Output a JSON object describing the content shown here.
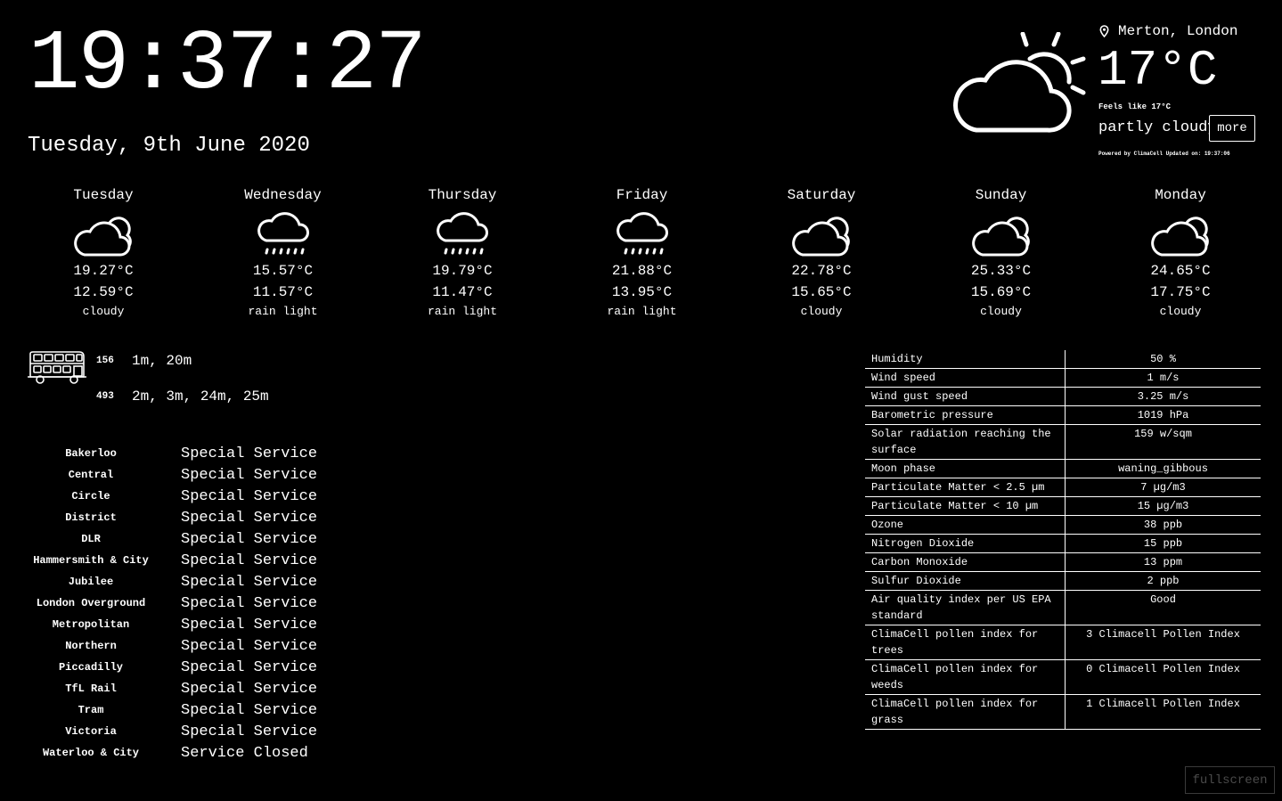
{
  "clock": {
    "time": "19:37:27",
    "date": "Tuesday, 9th June 2020"
  },
  "current": {
    "location": "Merton, London",
    "icon": "partly-cloudy-icon",
    "temperature": "17°C",
    "feels_like": "Feels like 17°C",
    "summary": "partly cloudy",
    "more_label": "more",
    "powered_by": "Powered by ClimaCell Updated on: 19:37:06"
  },
  "forecast": [
    {
      "day": "Tuesday",
      "icon": "cloudy-icon",
      "high": "19.27°C",
      "low": "12.59°C",
      "condition": "cloudy"
    },
    {
      "day": "Wednesday",
      "icon": "rain-light-icon",
      "high": "15.57°C",
      "low": "11.57°C",
      "condition": "rain light"
    },
    {
      "day": "Thursday",
      "icon": "rain-light-icon",
      "high": "19.79°C",
      "low": "11.47°C",
      "condition": "rain light"
    },
    {
      "day": "Friday",
      "icon": "rain-light-icon",
      "high": "21.88°C",
      "low": "13.95°C",
      "condition": "rain light"
    },
    {
      "day": "Saturday",
      "icon": "cloudy-icon",
      "high": "22.78°C",
      "low": "15.65°C",
      "condition": "cloudy"
    },
    {
      "day": "Sunday",
      "icon": "cloudy-icon",
      "high": "25.33°C",
      "low": "15.69°C",
      "condition": "cloudy"
    },
    {
      "day": "Monday",
      "icon": "cloudy-icon",
      "high": "24.65°C",
      "low": "17.75°C",
      "condition": "cloudy"
    }
  ],
  "buses": [
    {
      "route": "156",
      "times": "1m, 20m"
    },
    {
      "route": "493",
      "times": "2m, 3m, 24m, 25m"
    }
  ],
  "tube": [
    {
      "line": "Bakerloo",
      "status": "Special Service"
    },
    {
      "line": "Central",
      "status": "Special Service"
    },
    {
      "line": "Circle",
      "status": "Special Service"
    },
    {
      "line": "District",
      "status": "Special Service"
    },
    {
      "line": "DLR",
      "status": "Special Service"
    },
    {
      "line": "Hammersmith & City",
      "status": "Special Service"
    },
    {
      "line": "Jubilee",
      "status": "Special Service"
    },
    {
      "line": "London Overground",
      "status": "Special Service"
    },
    {
      "line": "Metropolitan",
      "status": "Special Service"
    },
    {
      "line": "Northern",
      "status": "Special Service"
    },
    {
      "line": "Piccadilly",
      "status": "Special Service"
    },
    {
      "line": "TfL Rail",
      "status": "Special Service"
    },
    {
      "line": "Tram",
      "status": "Special Service"
    },
    {
      "line": "Victoria",
      "status": "Special Service"
    },
    {
      "line": "Waterloo & City",
      "status": "Service Closed"
    }
  ],
  "details": [
    {
      "label": "Humidity",
      "value": "50 %"
    },
    {
      "label": "Wind speed",
      "value": "1 m/s"
    },
    {
      "label": "Wind gust speed",
      "value": "3.25 m/s"
    },
    {
      "label": "Barometric pressure",
      "value": "1019 hPa"
    },
    {
      "label": "Solar radiation reaching the surface",
      "value": "159 w/sqm"
    },
    {
      "label": "Moon phase",
      "value": "waning_gibbous"
    },
    {
      "label": "Particulate Matter < 2.5 µm",
      "value": "7 µg/m3"
    },
    {
      "label": "Particulate Matter < 10 µm",
      "value": "15 µg/m3"
    },
    {
      "label": "Ozone",
      "value": "38 ppb"
    },
    {
      "label": "Nitrogen Dioxide",
      "value": "15 ppb"
    },
    {
      "label": "Carbon Monoxide",
      "value": "13 ppm"
    },
    {
      "label": "Sulfur Dioxide",
      "value": "2 ppb"
    },
    {
      "label": "Air quality index per US EPA standard",
      "value": "Good"
    },
    {
      "label": "ClimaCell pollen index for trees",
      "value": "3 Climacell Pollen Index"
    },
    {
      "label": "ClimaCell pollen index for weeds",
      "value": "0 Climacell Pollen Index"
    },
    {
      "label": "ClimaCell pollen index for grass",
      "value": "1 Climacell Pollen Index"
    }
  ],
  "fullscreen_label": "fullscreen"
}
